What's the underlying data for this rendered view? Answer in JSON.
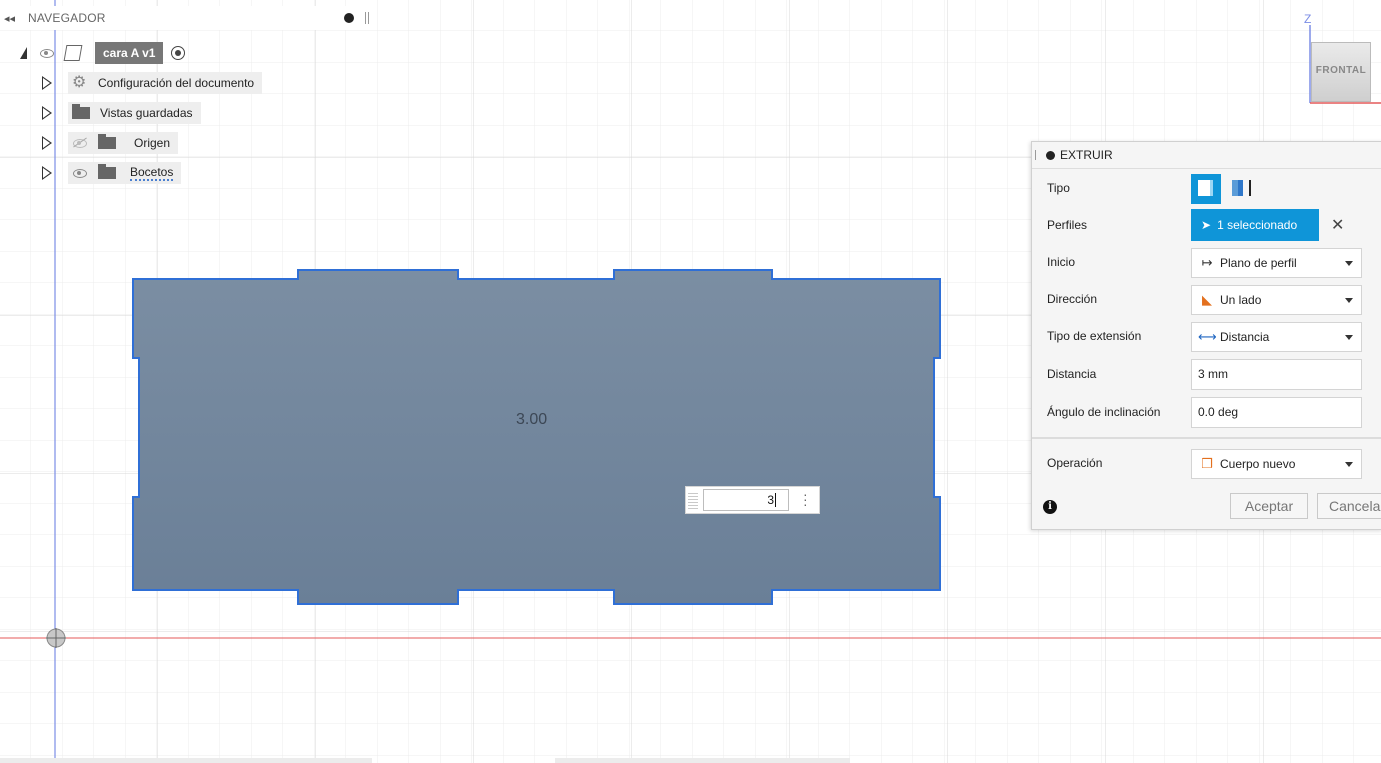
{
  "navigator": {
    "title": "NAVEGADOR",
    "root_label": "cara A v1",
    "items": [
      {
        "label": "Configuración del documento",
        "icon": "gear-icon"
      },
      {
        "label": "Vistas guardadas",
        "icon": "folder-icon"
      },
      {
        "label": "Origen",
        "icon": "folder-icon",
        "visibility": "hidden"
      },
      {
        "label": "Bocetos",
        "icon": "folder-icon",
        "visibility": "visible"
      }
    ]
  },
  "viewcube": {
    "face_label": "FRONTAL",
    "axis_label": "Z"
  },
  "extrude": {
    "title": "EXTRUIR",
    "rows": {
      "tipo": {
        "label": "Tipo"
      },
      "perfiles": {
        "label": "Perfiles",
        "value": "1 seleccionado"
      },
      "inicio": {
        "label": "Inicio",
        "value": "Plano de perfil"
      },
      "direccion": {
        "label": "Dirección",
        "value": "Un lado"
      },
      "tipo_extension": {
        "label": "Tipo de extensión",
        "value": "Distancia"
      },
      "distancia": {
        "label": "Distancia",
        "value": "3 mm"
      },
      "angulo": {
        "label": "Ángulo de inclinación",
        "value": "0.0 deg"
      },
      "operacion": {
        "label": "Operación",
        "value": "Cuerpo nuevo"
      }
    },
    "ok_label": "Aceptar",
    "cancel_label": "Cancelar",
    "selection_color": "#0f95d8"
  },
  "canvas": {
    "dimension_label": "3.00",
    "distance_input": "3",
    "profile_fill": "#6f849c",
    "profile_edge": "#2f6fd6",
    "x_axis_color": "#e45a5a",
    "z_axis_color": "#7c8ee6"
  }
}
